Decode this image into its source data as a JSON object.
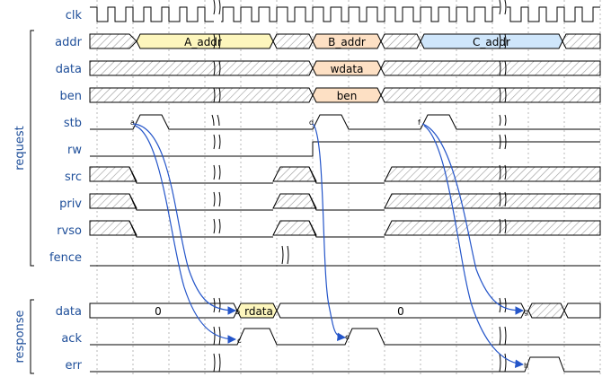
{
  "groups": {
    "request": "request",
    "response": "response"
  },
  "clock": {
    "name": "clk"
  },
  "request": {
    "addr": {
      "name": "addr",
      "values": [
        "A_addr",
        "B_addr",
        "C_addr"
      ]
    },
    "data": {
      "name": "data",
      "values": [
        "wdata"
      ]
    },
    "ben": {
      "name": "ben",
      "values": [
        "ben"
      ]
    },
    "stb": {
      "name": "stb",
      "annotations": [
        "a",
        "d",
        "f"
      ]
    },
    "rw": {
      "name": "rw"
    },
    "src": {
      "name": "src"
    },
    "priv": {
      "name": "priv"
    },
    "rvso": {
      "name": "rvso"
    },
    "fence": {
      "name": "fence"
    }
  },
  "response": {
    "data": {
      "name": "data",
      "values": [
        "0",
        "rdata",
        "0"
      ],
      "annotations": [
        "b",
        "g"
      ]
    },
    "ack": {
      "name": "ack",
      "annotations": [
        "c",
        "e"
      ]
    },
    "err": {
      "name": "err",
      "annotations": [
        "h"
      ]
    }
  },
  "colors": {
    "label": "#1f4f9a",
    "arrow": "#2455c9",
    "yellow": "#fdf6bd",
    "orange": "#fde0c4",
    "blue": "#cfe6fb"
  }
}
